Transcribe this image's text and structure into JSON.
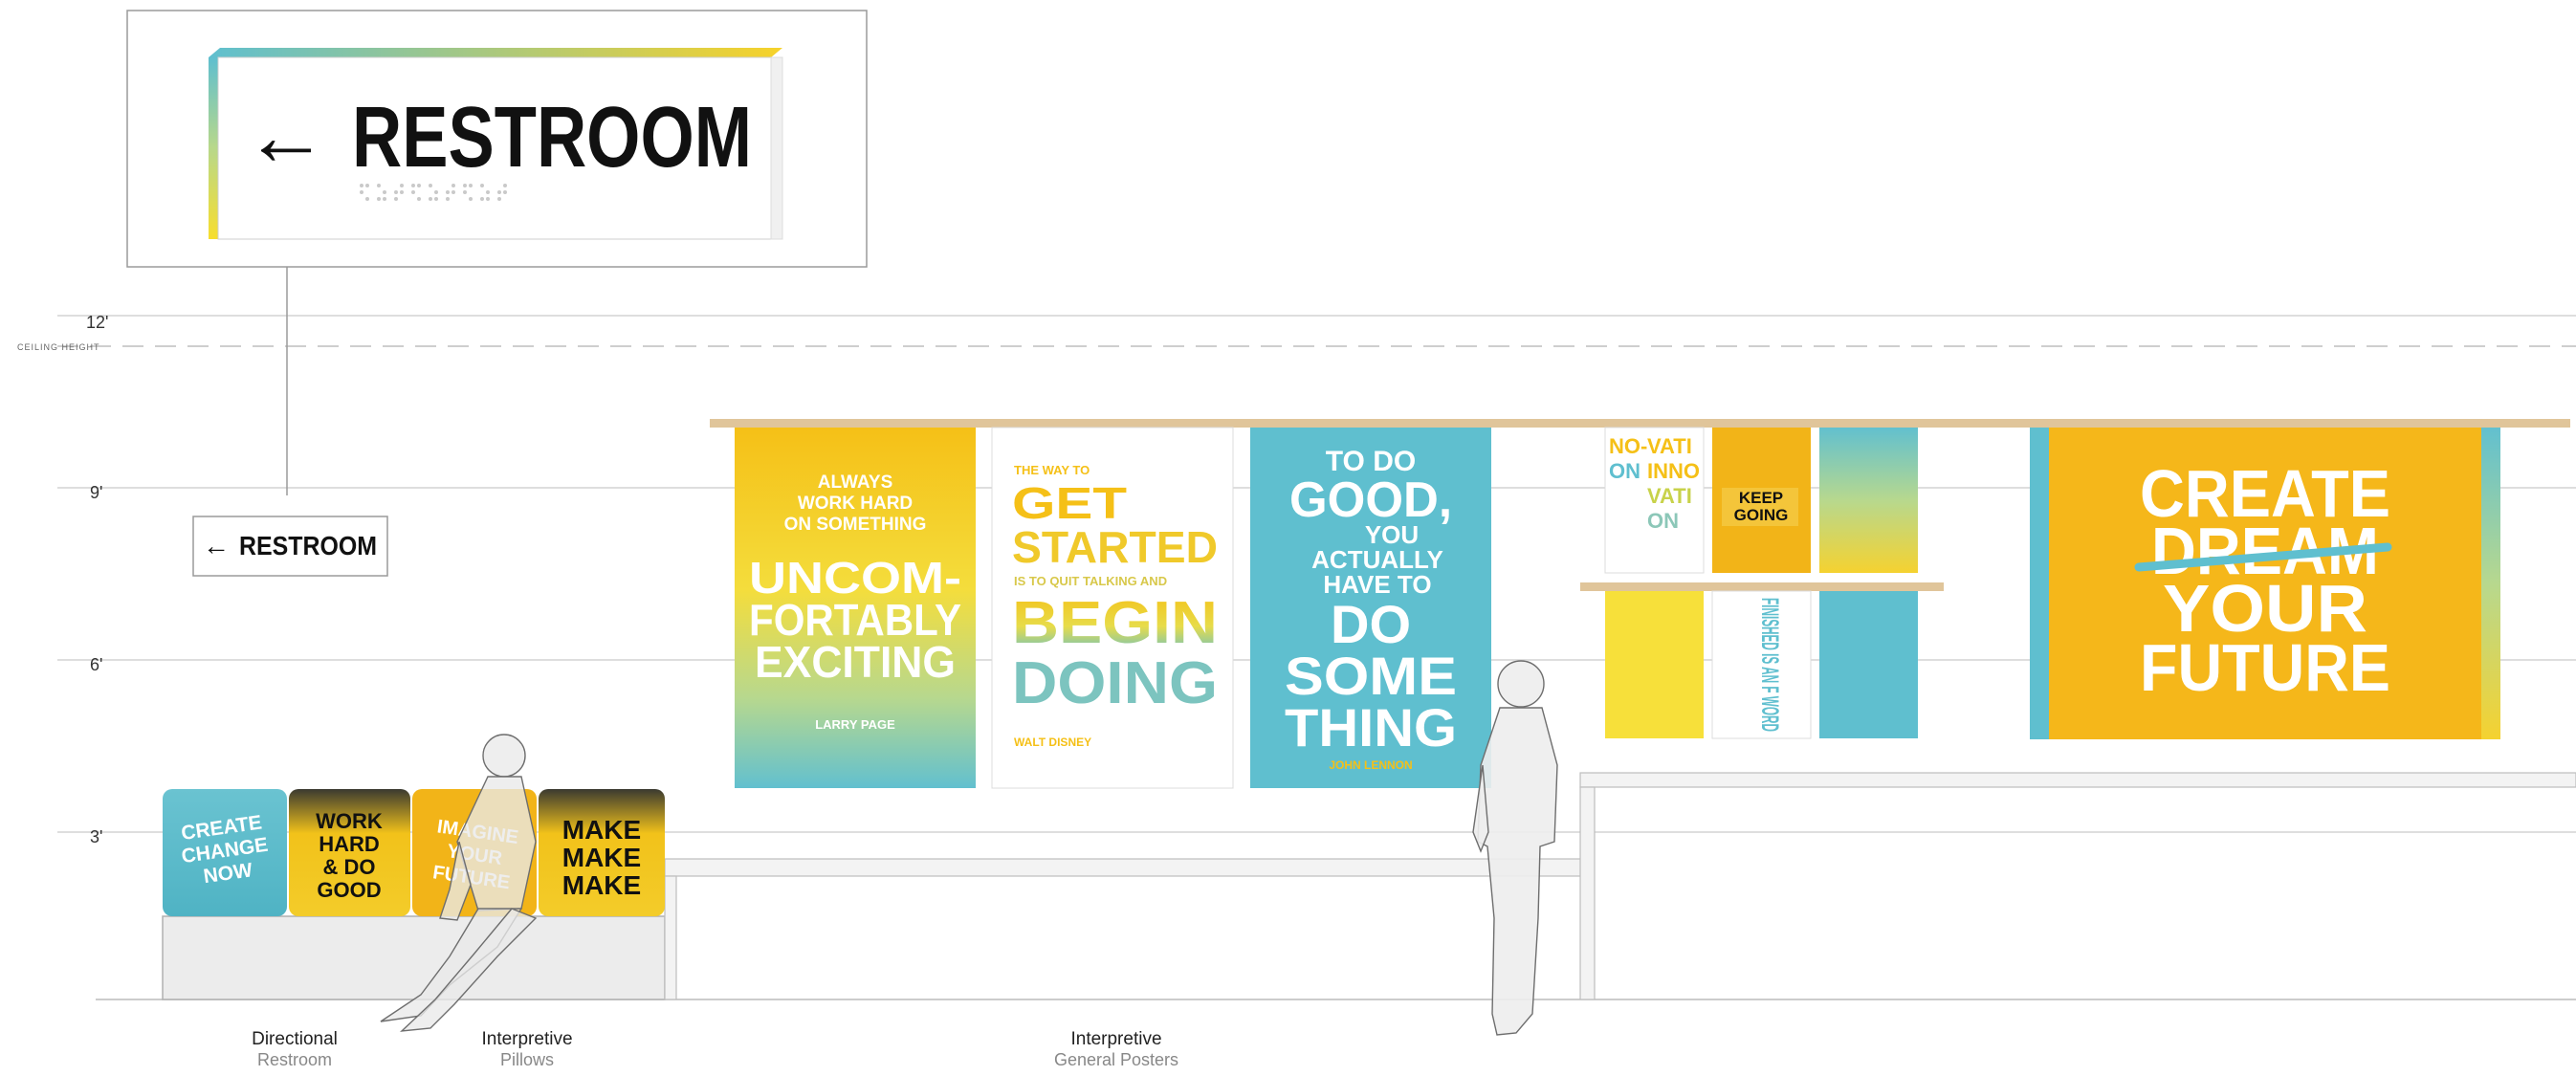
{
  "detail_sign": {
    "arrow": "←",
    "text": "RESTROOM"
  },
  "small_sign": {
    "arrow": "←",
    "text": "RESTROOM"
  },
  "height_marks": [
    {
      "label": "12'"
    },
    {
      "label": "9'"
    },
    {
      "label": "6'"
    },
    {
      "label": "3'"
    }
  ],
  "ceiling_label": "CEILING HEIGHT",
  "pillows": [
    {
      "lines": [
        "CREATE",
        "CHANGE",
        "NOW"
      ],
      "bg": "#5fbfcf"
    },
    {
      "lines": [
        "WORK",
        "HARD",
        "& DO",
        "GOOD"
      ],
      "bg": "#f2c21a"
    },
    {
      "lines": [
        "IMAGINE",
        "YOUR",
        "FUTURE"
      ],
      "bg": "#f2b418"
    },
    {
      "lines": [
        "MAKE",
        "MAKE",
        "MAKE"
      ],
      "bg": "#f2c21a"
    }
  ],
  "poster1": {
    "top": [
      "ALWAYS",
      "WORK HARD",
      "ON SOMETHING"
    ],
    "main": [
      "UNCOM-",
      "FORTABLY",
      "EXCITING"
    ],
    "attribution": "LARRY PAGE"
  },
  "poster2": {
    "pre": "THE WAY TO",
    "get": [
      "GET",
      "STARTED"
    ],
    "mid": "IS TO QUIT TALKING AND",
    "main": [
      "BEGIN",
      "DOING"
    ],
    "attribution": "WALT DISNEY"
  },
  "poster3": {
    "lines": [
      "TO DO",
      "GOOD,",
      "YOU",
      "ACTUALLY",
      "HAVE TO",
      "DO",
      "SOME",
      "THING"
    ],
    "attribution": "JOHN LENNON"
  },
  "small_posters": {
    "innovation": [
      "NO-",
      "VATI",
      "ON",
      "INNO",
      "VATI",
      "ON"
    ],
    "keep_going": [
      "KEEP",
      "GOING"
    ],
    "finished": "FINISHED IS AN F WORD"
  },
  "big_poster": {
    "lines": [
      "CREATE",
      "DREAM",
      "YOUR",
      "FUTURE"
    ]
  },
  "captions": [
    {
      "title": "Directional",
      "sub": "Restroom"
    },
    {
      "title": "Interpretive",
      "sub": "Pillows"
    },
    {
      "title": "Interpretive",
      "sub": "General Posters"
    }
  ],
  "colors": {
    "teal": "#5fbfcf",
    "yellow": "#f5c017",
    "bright_yellow": "#f7e03a",
    "green_teal": "#a9d49a",
    "wood": "#e0c59a"
  }
}
